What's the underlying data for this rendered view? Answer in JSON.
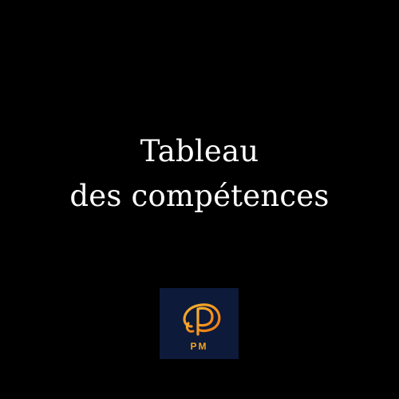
{
  "title": {
    "line1": "Tableau",
    "line2": "des compétences"
  },
  "logo": {
    "text": "PM",
    "background_color": "#0d1a3a",
    "accent_color": "#f28a1a",
    "accent_secondary": "#f6b12e",
    "text_color": "#f2a31f"
  },
  "background_color": "#000000"
}
